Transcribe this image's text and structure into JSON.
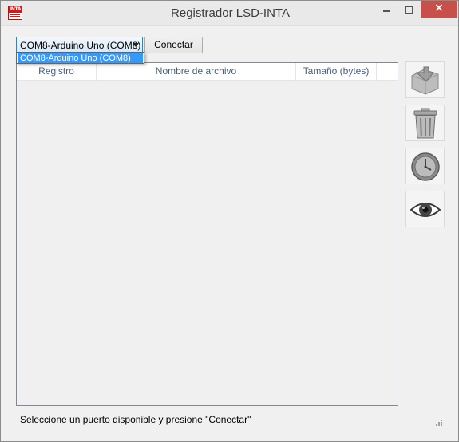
{
  "window": {
    "title": "Registrador LSD-INTA",
    "logo_text": "INTA",
    "close_glyph": "×"
  },
  "toolbar": {
    "port_selected": "COM8-Arduino Uno (COM8)",
    "port_options": [
      "COM8-Arduino Uno (COM8)"
    ],
    "connect_label": "Conectar"
  },
  "table": {
    "columns": [
      "Registro",
      "Nombre de archivo",
      "Tamaño (bytes)"
    ],
    "rows": []
  },
  "side_buttons": [
    {
      "name": "download",
      "icon": "folder-download-icon"
    },
    {
      "name": "delete",
      "icon": "trash-icon"
    },
    {
      "name": "schedule",
      "icon": "clock-icon"
    },
    {
      "name": "view",
      "icon": "eye-icon"
    }
  ],
  "status": {
    "message": "Seleccione un puerto disponible y presione \"Conectar\""
  }
}
